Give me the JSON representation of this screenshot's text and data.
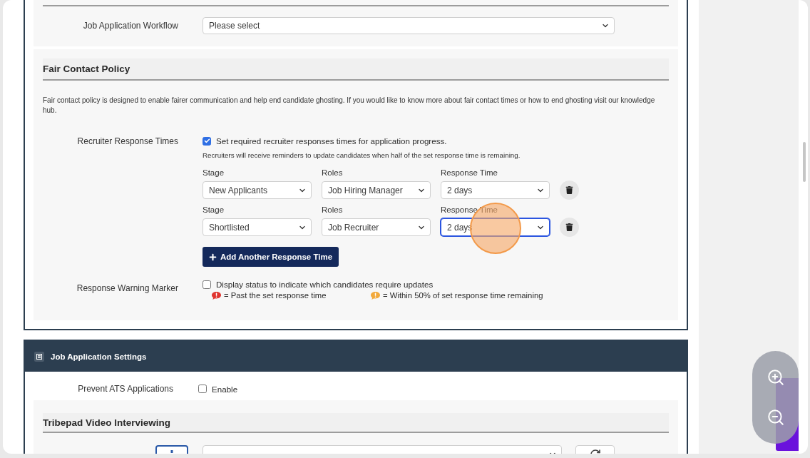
{
  "workflow": {
    "label": "Job Application Workflow",
    "value": "Please select"
  },
  "fair_contact_policy": {
    "title": "Fair Contact Policy",
    "description": "Fair contact policy is designed to enable fairer communication and help end candidate ghosting. If you would like to know more about fair contact times or how to end ghosting visit our knowledge hub.",
    "response_times": {
      "label": "Recruiter Response Times",
      "checked": true,
      "option": "Set required recruiter responses times for application progress.",
      "note": "Recruiters will receive reminders to update candidates when half of the set response time is remaining.",
      "rows": [
        {
          "stage_label": "Stage",
          "stage": "New Applicants",
          "roles_label": "Roles",
          "role": "Job Hiring Manager",
          "time_label": "Response Time",
          "time": "2 days",
          "time_focused": false
        },
        {
          "stage_label": "Stage",
          "stage": "Shortlisted",
          "roles_label": "Roles",
          "role": "Job Recruiter",
          "time_label": "Response Time",
          "time": "2 days",
          "time_focused": true
        }
      ],
      "add_button": "Add Another Response Time"
    },
    "warning_marker": {
      "label": "Response Warning Marker",
      "checked": false,
      "option": "Display status to indicate which candidates require updates",
      "legend": [
        {
          "text": "= Past the set response time",
          "color": "#e0342f"
        },
        {
          "text": "= Within 50% of set response time remaining",
          "color": "#f2a93b"
        }
      ]
    }
  },
  "job_application_settings": {
    "title": "Job Application Settings",
    "prevent_ats": {
      "label": "Prevent ATS Applications",
      "checked": false,
      "option": "Enable"
    },
    "video_interviewing": {
      "title": "Tribepad Video Interviewing"
    }
  }
}
